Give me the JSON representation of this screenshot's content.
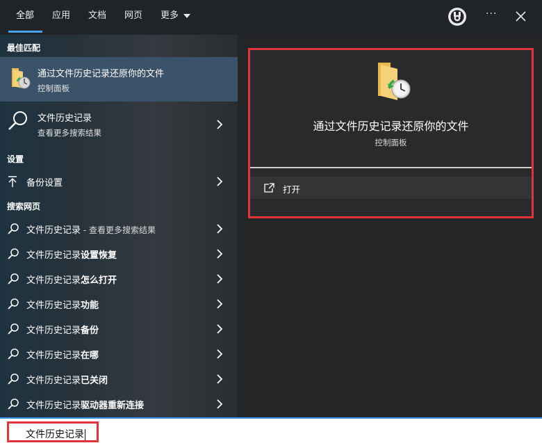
{
  "tabs": [
    {
      "label": "全部"
    },
    {
      "label": "应用"
    },
    {
      "label": "文档"
    },
    {
      "label": "网页"
    },
    {
      "label": "更多"
    }
  ],
  "toolbar": {
    "rewards_icon": "medal-icon",
    "more_label": "···",
    "close_icon": "close-icon"
  },
  "sections": {
    "best_match": "最佳匹配",
    "settings": "设置",
    "web": "搜索网页"
  },
  "best_match": {
    "title": "通过文件历史记录还原你的文件",
    "subtitle": "控制面板",
    "icon": "folder-history-icon"
  },
  "search_result": {
    "title": "文件历史记录",
    "subtitle": "查看更多搜索结果"
  },
  "settings_item": {
    "label": "备份设置"
  },
  "web_items": [
    {
      "prefix": "文件历史记录",
      "rest": " - 查看更多搜索结果",
      "bold": false
    },
    {
      "prefix": "文件历史记录",
      "rest": "设置恢复",
      "bold": true
    },
    {
      "prefix": "文件历史记录",
      "rest": "怎么打开",
      "bold": true
    },
    {
      "prefix": "文件历史记录",
      "rest": "功能",
      "bold": true
    },
    {
      "prefix": "文件历史记录",
      "rest": "备份",
      "bold": true
    },
    {
      "prefix": "文件历史记录",
      "rest": "在哪",
      "bold": true
    },
    {
      "prefix": "文件历史记录",
      "rest": "已关闭",
      "bold": true
    },
    {
      "prefix": "文件历史记录",
      "rest": "驱动器重新连接",
      "bold": true
    }
  ],
  "preview": {
    "title": "通过文件历史记录还原你的文件",
    "subtitle": "控制面板",
    "action_label": "打开"
  },
  "search": {
    "value": "文件历史记录"
  },
  "colors": {
    "accent": "#4aa2ef",
    "highlight_border": "#e0333a",
    "selected_row": "#3b5368"
  }
}
